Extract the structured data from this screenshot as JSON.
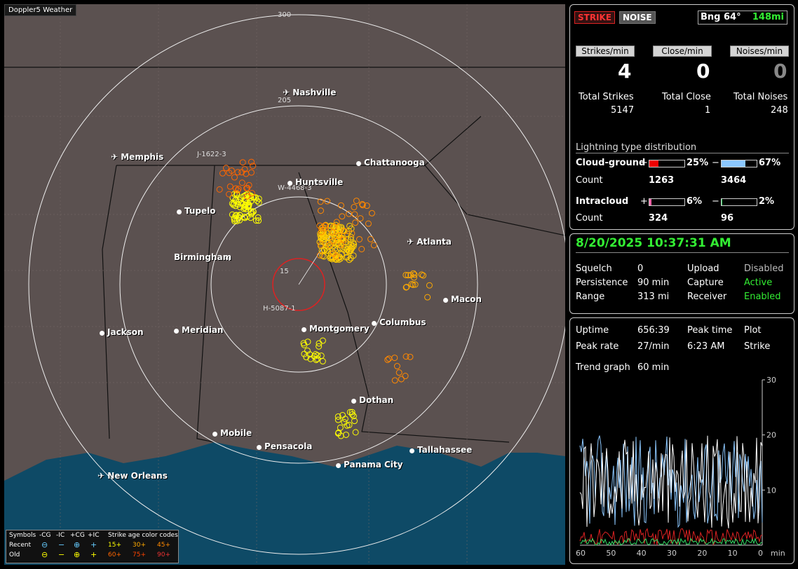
{
  "map": {
    "title": "Doppler5 Weather",
    "ring_labels": [
      "300",
      "205",
      "15"
    ],
    "stations": [
      "J-1622-3",
      "W-4468-3",
      "H-5087-1"
    ],
    "cities": [
      {
        "name": "Nashville",
        "airport": true
      },
      {
        "name": "Memphis",
        "airport": true
      },
      {
        "name": "Chattanooga",
        "airport": false
      },
      {
        "name": "Huntsville",
        "airport": false
      },
      {
        "name": "Tupelo",
        "airport": false
      },
      {
        "name": "Atlanta",
        "airport": true
      },
      {
        "name": "Birmingham",
        "airport": false
      },
      {
        "name": "Macon",
        "airport": false
      },
      {
        "name": "Jackson",
        "airport": false
      },
      {
        "name": "Meridian",
        "airport": false
      },
      {
        "name": "Montgomery",
        "airport": false
      },
      {
        "name": "Columbus",
        "airport": false
      },
      {
        "name": "Dothan",
        "airport": false
      },
      {
        "name": "Mobile",
        "airport": false
      },
      {
        "name": "Pensacola",
        "airport": false
      },
      {
        "name": "Tallahassee",
        "airport": false
      },
      {
        "name": "Panama City",
        "airport": false
      },
      {
        "name": "New Orleans",
        "airport": true
      }
    ]
  },
  "legend": {
    "symbols_label": "Symbols",
    "cg_neg": "-CG",
    "ic_neg": "-IC",
    "cg_pos": "+CG",
    "ic_pos": "+IC",
    "age_label": "Strike age color codes",
    "recent": "Recent",
    "old": "Old",
    "ages_recent": [
      "15+",
      "30+",
      "45+"
    ],
    "ages_old": [
      "60+",
      "75+",
      "90+"
    ],
    "sym_cg_neg": "⊖",
    "sym_ic_neg": "−",
    "sym_cg_pos": "⊕",
    "sym_ic_pos": "+"
  },
  "header": {
    "strike_btn": "STRIKE",
    "noise_btn": "NOISE",
    "bearing": "Bng 64°",
    "distance": "148mi"
  },
  "rates": {
    "strikes_label": "Strikes/min",
    "strikes_value": "4",
    "close_label": "Close/min",
    "close_value": "0",
    "noises_label": "Noises/min",
    "noises_value": "0"
  },
  "totals": {
    "strikes_label": "Total Strikes",
    "strikes_value": "5147",
    "close_label": "Total Close",
    "close_value": "1",
    "noises_label": "Total Noises",
    "noises_value": "248"
  },
  "distribution": {
    "title": "Lightning type distribution",
    "cg_label": "Cloud-ground",
    "ic_label": "Intracloud",
    "count_label": "Count",
    "plus": "+",
    "minus": "−",
    "cg_pos_pct": "25%",
    "cg_neg_pct": "67%",
    "cg_pos_count": "1263",
    "cg_neg_count": "3464",
    "ic_pos_pct": "6%",
    "ic_neg_pct": "2%",
    "ic_pos_count": "324",
    "ic_neg_count": "96",
    "cg_pos_frac": 0.25,
    "cg_neg_frac": 0.67,
    "ic_pos_frac": 0.06,
    "ic_neg_frac": 0.02
  },
  "status": {
    "datetime": "8/20/2025 10:37:31 AM",
    "squelch_label": "Squelch",
    "squelch_value": "0",
    "upload_label": "Upload",
    "upload_value": "Disabled",
    "persistence_label": "Persistence",
    "persistence_value": "90 min",
    "capture_label": "Capture",
    "capture_value": "Active",
    "range_label": "Range",
    "range_value": "313 mi",
    "receiver_label": "Receiver",
    "receiver_value": "Enabled"
  },
  "stats": {
    "uptime_label": "Uptime",
    "uptime_value": "656:39",
    "peak_time_label": "Peak time",
    "plot_label": "Plot",
    "peak_rate_label": "Peak rate",
    "peak_rate_value": "27/min",
    "peak_time_value": "6:23 AM",
    "plot_value": "Strike",
    "trend_label": "Trend graph",
    "trend_value": "60 min"
  },
  "chart_data": {
    "type": "line",
    "x_ticks": [
      "60",
      "50",
      "40",
      "30",
      "20",
      "10",
      "0"
    ],
    "x_unit": "min",
    "y_ticks": [
      "30",
      "20",
      "10"
    ],
    "ylim": [
      0,
      30
    ]
  },
  "colors": {
    "strike_red": "#d22",
    "cg_neg_blue": "#8cc8ff",
    "ic_pink": "#ff66aa",
    "ic_green": "#33dd66",
    "status_green": "#33ee33"
  }
}
